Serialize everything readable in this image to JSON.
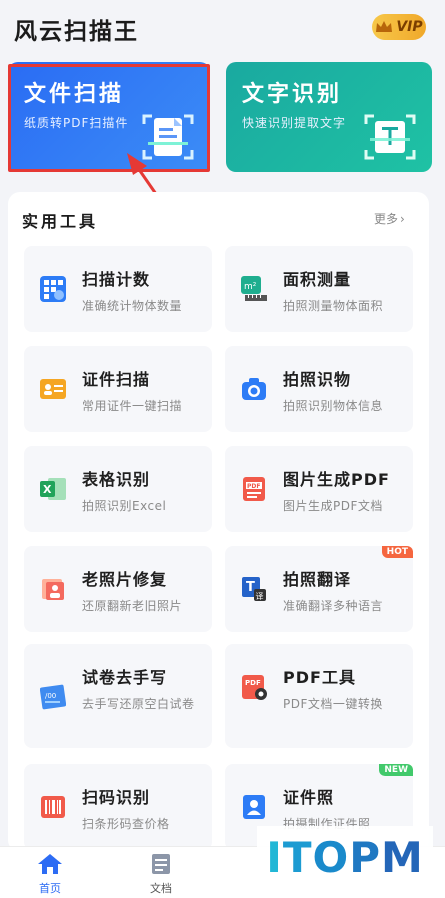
{
  "header": {
    "title": "风云扫描王",
    "vip_label": "VIP"
  },
  "cards": [
    {
      "title": "文件扫描",
      "subtitle": "纸质转PDF扫描件",
      "icon": "document-scan-icon"
    },
    {
      "title": "文字识别",
      "subtitle": "快速识别提取文字",
      "icon": "text-recognition-icon"
    }
  ],
  "tools": {
    "title": "实用工具",
    "more": "更多",
    "items": [
      {
        "name": "扫描计数",
        "desc": "准确统计物体数量",
        "icon": "count-grid-icon"
      },
      {
        "name": "面积测量",
        "desc": "拍照测量物体面积",
        "icon": "area-measure-icon"
      },
      {
        "name": "证件扫描",
        "desc": "常用证件一键扫描",
        "icon": "id-card-icon"
      },
      {
        "name": "拍照识物",
        "desc": "拍照识别物体信息",
        "icon": "camera-icon"
      },
      {
        "name": "表格识别",
        "desc": "拍照识别Excel",
        "icon": "excel-icon"
      },
      {
        "name": "图片生成PDF",
        "desc": "图片生成PDF文档",
        "icon": "pdf-icon"
      },
      {
        "name": "老照片修复",
        "desc": "还原翻新老旧照片",
        "icon": "photo-restore-icon"
      },
      {
        "name": "拍照翻译",
        "desc": "准确翻译多种语言",
        "icon": "translate-icon",
        "badge": "HOT"
      },
      {
        "name": "试卷去手写",
        "desc": "去手写还原空白试卷",
        "icon": "exam-paper-icon"
      },
      {
        "name": "PDF工具",
        "desc": "PDF文档一键转换",
        "icon": "pdf-tools-icon"
      },
      {
        "name": "扫码识别",
        "desc": "扫条形码查价格",
        "icon": "barcode-icon"
      },
      {
        "name": "证件照",
        "desc": "拍摄制作证件照",
        "icon": "id-photo-icon",
        "badge": "NEW"
      }
    ]
  },
  "tabbar": {
    "tabs": [
      {
        "label": "首页",
        "icon": "home-icon",
        "active": true
      },
      {
        "label": "文档",
        "icon": "document-icon",
        "active": false
      }
    ]
  },
  "watermark": {
    "text": "ITOPM"
  },
  "colors": {
    "accent": "#2a6cf4",
    "teal": "#1fb3a2",
    "highlight": "#e53935",
    "hot": "#f5663f",
    "new": "#42c96b"
  }
}
